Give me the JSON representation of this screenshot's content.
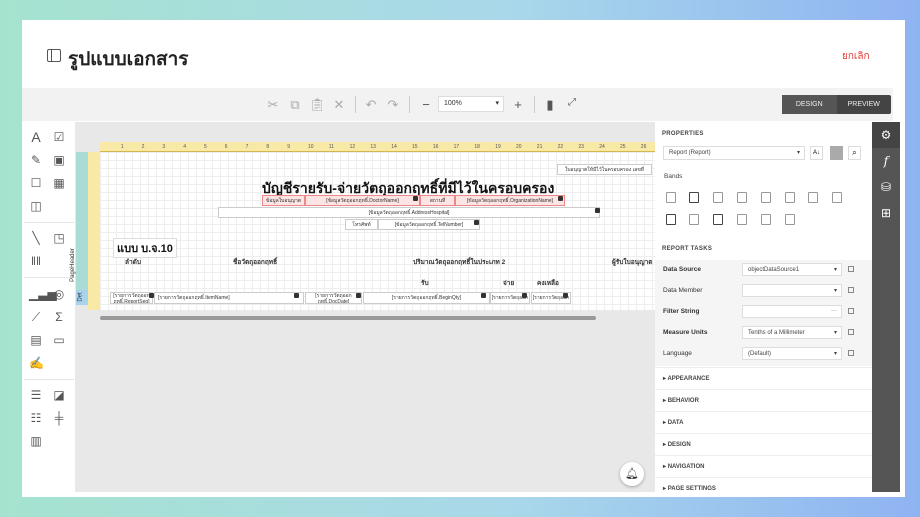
{
  "header": {
    "title": "รูปแบบเอกสาร",
    "cancel": "ยกเลิก"
  },
  "toolbar": {
    "zoom": "100%",
    "design": "DESIGN",
    "preview": "PREVIEW"
  },
  "report": {
    "license_no": "ใบอนุญาตให้มีไว้ในครอบครอง เลขที่",
    "title": "บัญชีรายรับ-จ่ายวัตถุออกฤทธิ์ที่มีไว้ในครอบครอง",
    "license_label": "ข้อมูลใบอนุญาต",
    "doctor": "[ข้อมูลวัตถุออกฤทธิ์.DoctorName]",
    "place_label": "สถานที่",
    "org": "[ข้อมูลวัตถุออกฤทธิ์.OrganizationName]",
    "address": "[ข้อมูลวัตถุออกฤทธิ์.AddressHospital]",
    "tel_label": "โทรศัพท์",
    "tel": "[ข้อมูลวัตถุออกฤทธิ์.TelNumber]",
    "form": "แบบ บ.จ.10",
    "col_no": "ลำดับ",
    "col_name": "ชื่อวัตถุออกฤทธิ์",
    "col_qty": "ปริมาณวัตถุออกฤทธิ์ในประเภท 2",
    "col_recv": "ผู้รับใบอนุญาต",
    "sub_in": "รับ",
    "sub_out": "จ่าย",
    "sub_bal": "คงเหลือ",
    "d_seq": "[รายการวัตถุออกฤทธิ์.ReportSeq]",
    "d_item": "[รายการวัตถุออกฤทธิ์.ItemName]",
    "d_date": "[รายการวัตถุออกฤทธิ์.DocDate]",
    "d_begin": "[รายการวัตถุออกฤทธิ์.BeginQty]",
    "d_out": "[รายการวัตถุออก",
    "d_bal": "[รายการวัตถุออก",
    "band_header": "PageHeader",
    "band_detail": "Det",
    "ruler": [
      "1",
      "2",
      "3",
      "4",
      "5",
      "6",
      "7",
      "8",
      "9",
      "10",
      "11",
      "12",
      "13",
      "14",
      "15",
      "16",
      "17",
      "18",
      "19",
      "20",
      "21",
      "22",
      "23",
      "24",
      "25",
      "26"
    ]
  },
  "properties": {
    "title": "PROPERTIES",
    "object": "Report (Report)",
    "bands": "Bands",
    "tasks": "REPORT TASKS",
    "rows": [
      {
        "name": "Data Source",
        "value": "objectDataSource1"
      },
      {
        "name": "Data Member",
        "value": ""
      },
      {
        "name": "Filter String",
        "value": ""
      },
      {
        "name": "Measure Units",
        "value": "Tenths of a Millimeter"
      },
      {
        "name": "Language",
        "value": "(Default)"
      }
    ],
    "sections": [
      "APPEARANCE",
      "BEHAVIOR",
      "DATA",
      "DESIGN",
      "NAVIGATION",
      "PAGE SETTINGS"
    ]
  }
}
